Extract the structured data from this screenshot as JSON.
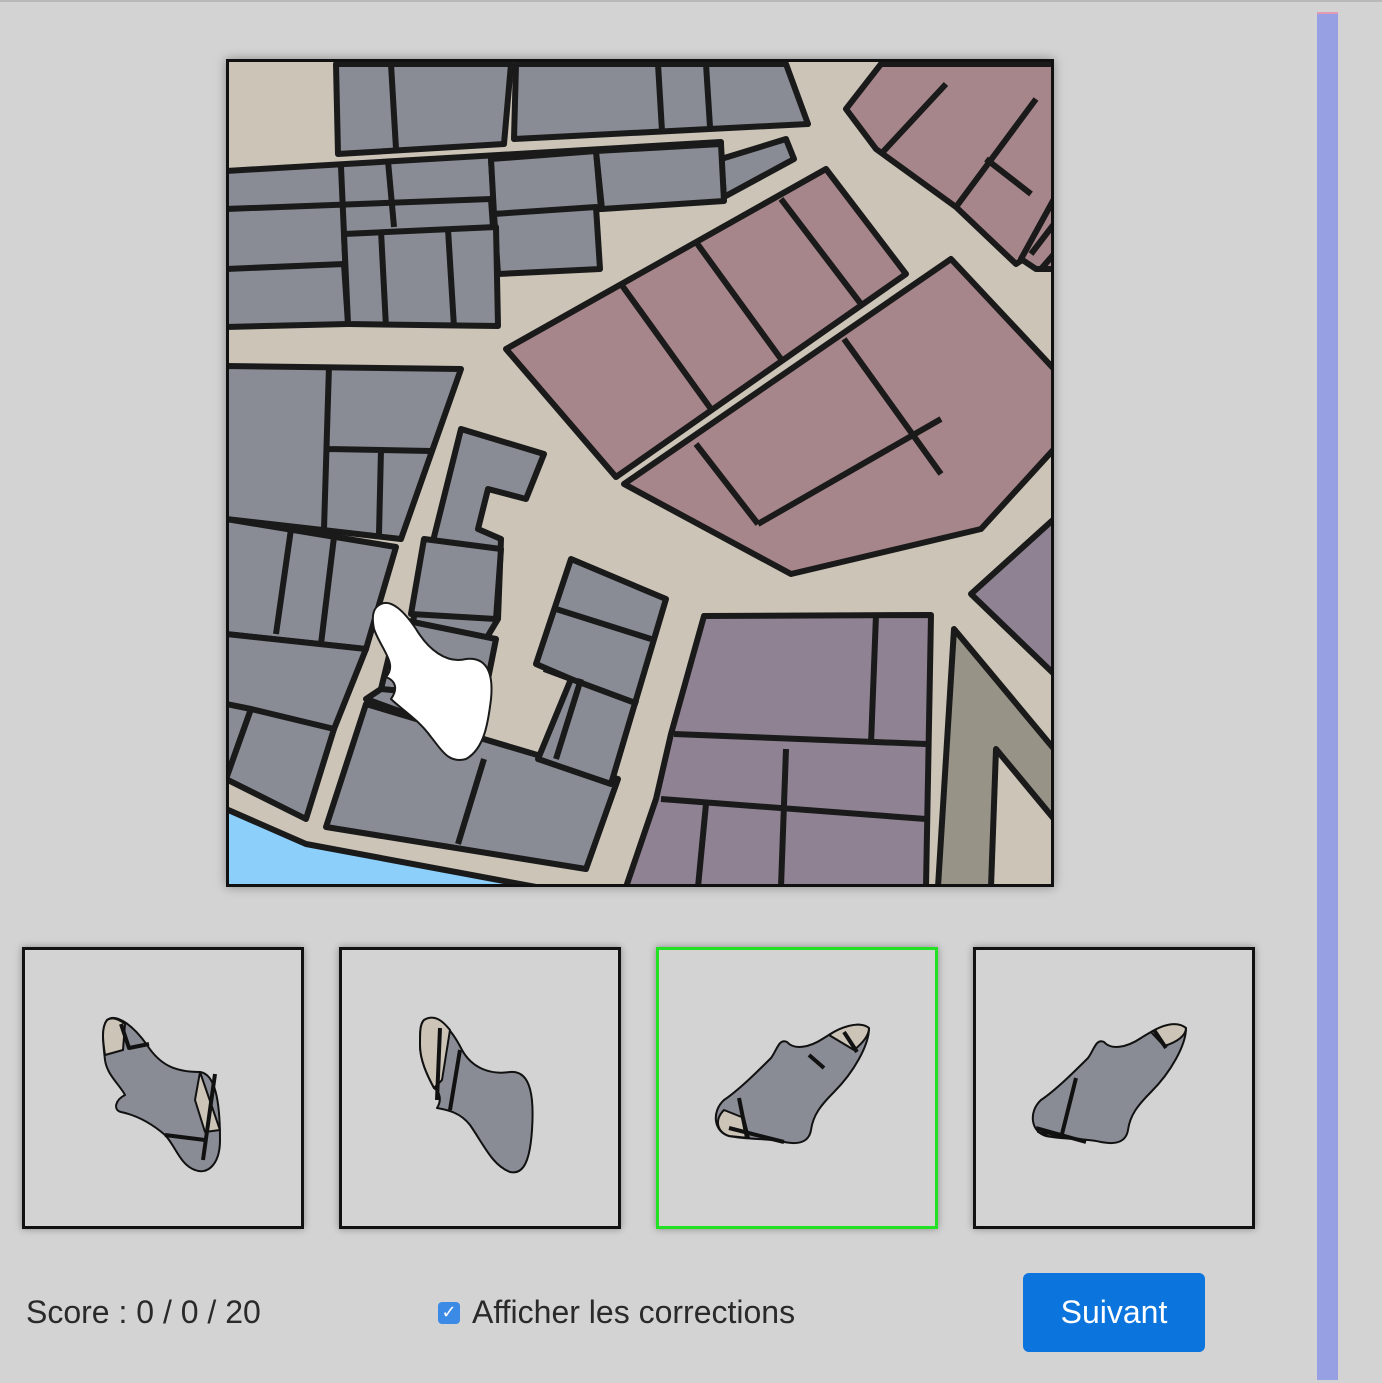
{
  "game": {
    "map_colors": {
      "background": "#cbc4b7",
      "grey_buildings": "#898c95",
      "pink_buildings": "#a6868a",
      "purple_buildings": "#8f8293",
      "road": "#989387",
      "water": "#8ccffa",
      "outline": "#1a1a1a",
      "highlight_shape": "#ffffff"
    },
    "choices": [
      {
        "id": "choice-1",
        "is_correct": false
      },
      {
        "id": "choice-2",
        "is_correct": false
      },
      {
        "id": "choice-3",
        "is_correct": true
      },
      {
        "id": "choice-4",
        "is_correct": false
      }
    ],
    "correct_border_color": "#22e022"
  },
  "footer": {
    "score_label": "Score : 0 / 0 / 20",
    "show_corrections_label": "Afficher les corrections",
    "show_corrections_checked": true,
    "checkbox_glyph": "✓",
    "next_button_label": "Suivant"
  },
  "scrollbar": {
    "color": "#97a0e2"
  }
}
